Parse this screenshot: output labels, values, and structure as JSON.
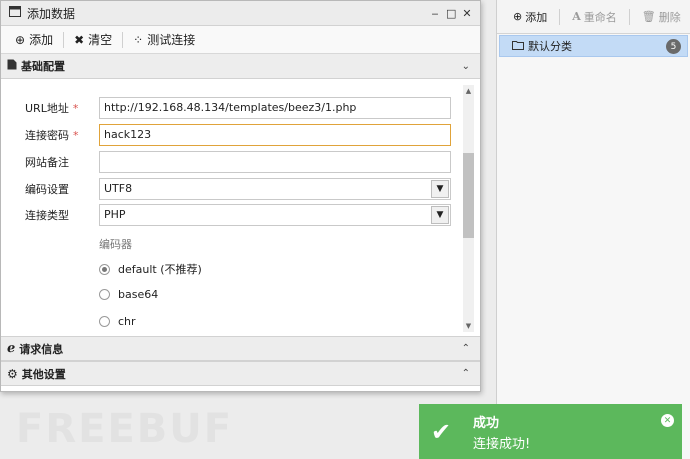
{
  "dialog": {
    "title": "添加数据",
    "controls": {
      "minimize": "‒",
      "maximize": "□",
      "close": "✕"
    }
  },
  "actions": {
    "add": "添加",
    "clear": "清空",
    "test": "测试连接"
  },
  "sections": {
    "basic": "基础配置",
    "request": "请求信息",
    "other": "其他设置"
  },
  "form": {
    "url": {
      "label": "URL地址",
      "value": "http://192.168.48.134/templates/beez3/1.php"
    },
    "password": {
      "label": "连接密码",
      "value": "hack123"
    },
    "note": {
      "label": "网站备注",
      "value": ""
    },
    "encoding": {
      "label": "编码设置",
      "value": "UTF8"
    },
    "type": {
      "label": "连接类型",
      "value": "PHP"
    },
    "required_mark": "*",
    "encoder_title": "编码器",
    "encoders": [
      {
        "label": "default (不推荐)",
        "checked": true
      },
      {
        "label": "base64",
        "checked": false
      },
      {
        "label": "chr",
        "checked": false
      }
    ]
  },
  "right_panel": {
    "add": "添加",
    "rename": "重命名",
    "delete": "删除",
    "category": "默认分类",
    "category_count": "5"
  },
  "watermark": "FREEBUF",
  "toast": {
    "title": "成功",
    "message": "连接成功!"
  }
}
